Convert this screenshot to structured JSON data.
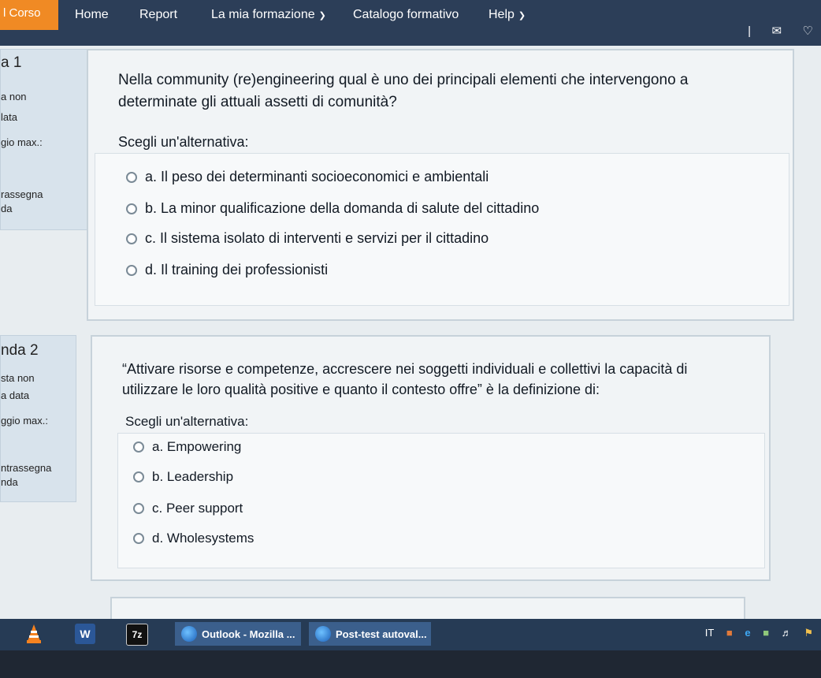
{
  "navbar": {
    "brand": "l Corso",
    "items": [
      {
        "label": "Home",
        "dropdown": false
      },
      {
        "label": "Report",
        "dropdown": false
      },
      {
        "label": "La mia formazione",
        "dropdown": true
      },
      {
        "label": "Catalogo formativo",
        "dropdown": false
      },
      {
        "label": "Help",
        "dropdown": true
      }
    ],
    "icons": [
      "divider-icon",
      "mail-icon",
      "bell-icon"
    ]
  },
  "questions": [
    {
      "info": {
        "number": "a 1",
        "lines": [
          "a non",
          "lata",
          "gio max.:",
          "rassegna",
          "da"
        ]
      },
      "text": "Nella community (re)engineering qual è uno dei principali elementi che intervengono a determinate gli attuali assetti di comunità?",
      "text_lines": [
        "Nella community (re)engineering qual è uno dei principali elementi che intervengono a",
        "determinate gli attuali assetti di comunità?"
      ],
      "prompt": "Scegli un'alternativa:",
      "options": [
        "a. Il peso dei determinanti socioeconomici e ambientali",
        "b. La minor qualificazione della domanda di salute del cittadino",
        "c. Il sistema isolato di interventi e servizi per il cittadino",
        "d. Il training dei professionisti"
      ]
    },
    {
      "info": {
        "number": "nda 2",
        "lines": [
          "sta non",
          "a data",
          "ggio max.:",
          "ntrassegna",
          "nda"
        ]
      },
      "text_lines": [
        "“Attivare risorse e competenze, accrescere nei soggetti individuali e collettivi la capacità di",
        "utilizzare le loro qualità positive e quanto il contesto offre” è la definizione di:"
      ],
      "prompt": "Scegli un'alternativa:",
      "options": [
        "a. Empowering",
        "b. Leadership",
        "c. Peer support",
        "d. Wholesystems"
      ]
    }
  ],
  "taskbar": {
    "buttons": [
      "Outlook - Mozilla ...",
      "Post-test autoval..."
    ],
    "app_icons": [
      "vlc-icon",
      "word-icon",
      "7zip-icon"
    ],
    "word_label": "W",
    "zip_label": "7z",
    "tray": {
      "lang": "IT"
    }
  },
  "colors": {
    "navbar": "#2c3e58",
    "brand": "#f08a24",
    "taskbar": "#263b55",
    "task_button": "#3b5f8c"
  }
}
